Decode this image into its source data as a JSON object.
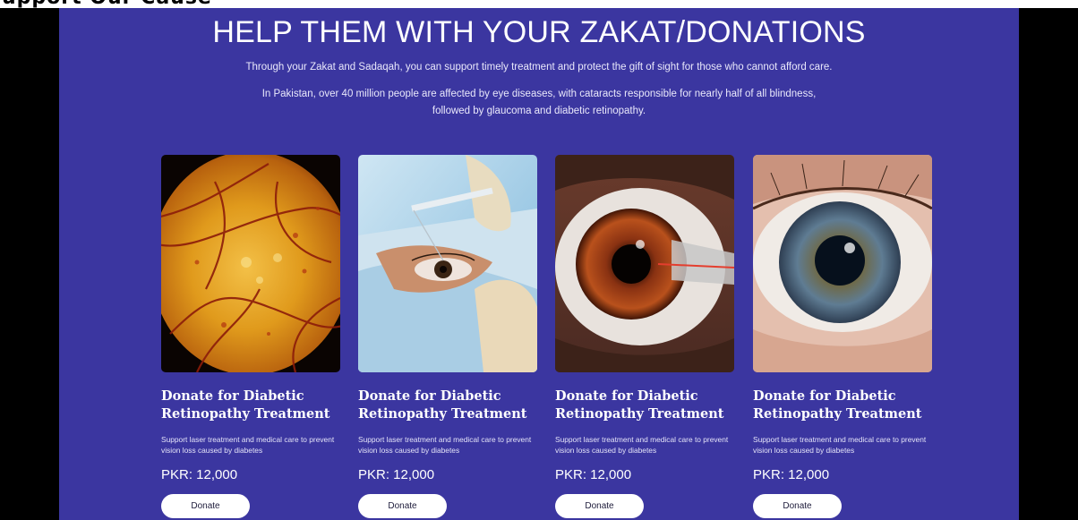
{
  "page_heading_cropped": "upport Our Cause",
  "hero": {
    "title": "HELP THEM WITH YOUR ZAKAT/DONATIONS",
    "subtitle": "Through your Zakat and Sadaqah, you can support timely treatment and protect the gift of sight for those who cannot afford care.",
    "body": "In Pakistan, over 40 million people are affected by eye diseases, with cataracts responsible for nearly half of all blindness, followed by glaucoma and diabetic retinopathy."
  },
  "cards": [
    {
      "image": "retina-fundus-photo",
      "title": "Donate for Diabetic Retinopathy Treatment",
      "description": "Support laser treatment and medical care to prevent vision loss caused by diabetes",
      "price": "PKR: 12,000",
      "button": "Donate"
    },
    {
      "image": "eye-surgery-photo",
      "title": "Donate for Diabetic Retinopathy Treatment",
      "description": "Support laser treatment and medical care to prevent vision loss caused by diabetes",
      "price": "PKR: 12,000",
      "button": "Donate"
    },
    {
      "image": "eye-laser-procedure-photo",
      "title": "Donate for Diabetic Retinopathy Treatment",
      "description": "Support laser treatment and medical care to prevent vision loss caused by diabetes",
      "price": "PKR: 12,000",
      "button": "Donate"
    },
    {
      "image": "eye-closeup-photo",
      "title": "Donate for Diabetic Retinopathy Treatment",
      "description": "Support laser treatment and medical care to prevent vision loss caused by diabetes",
      "price": "PKR: 12,000",
      "button": "Donate"
    }
  ],
  "colors": {
    "panel_background": "#3b36a0",
    "button_background": "#ffffff",
    "text_primary": "#ffffff"
  }
}
